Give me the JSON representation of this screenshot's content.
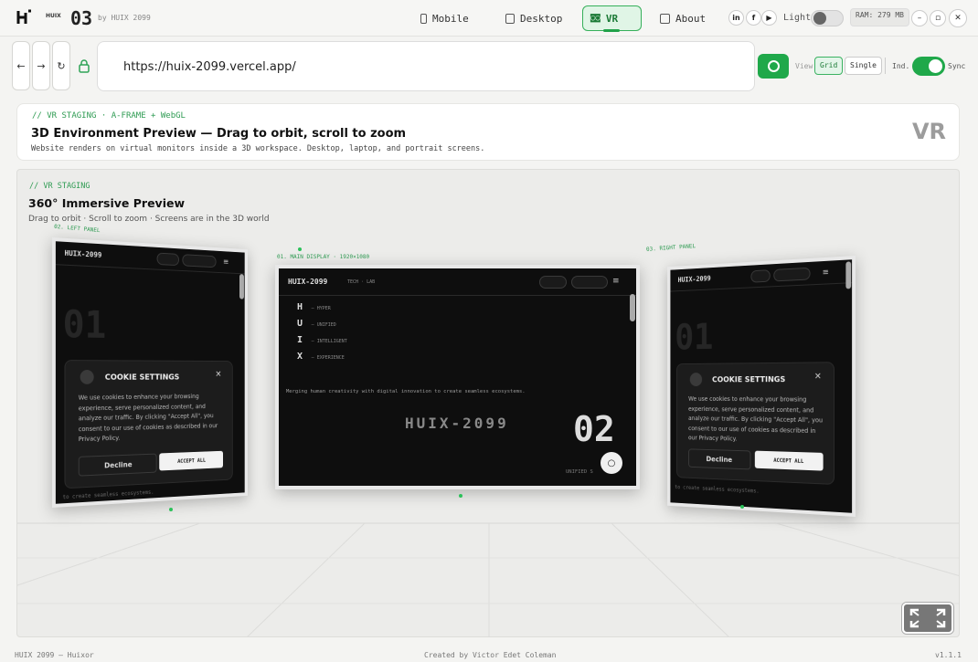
{
  "topbar": {
    "logo_icon": "huix-logo-icon",
    "brand_small": "HUIX",
    "number": "03",
    "byline": "by HUIX 2099",
    "nav": [
      {
        "label": "Mobile",
        "icon": "mobile-icon",
        "active": false
      },
      {
        "label": "Desktop",
        "icon": "desktop-icon",
        "active": false
      },
      {
        "label": "VR",
        "icon": "vr-headset-icon",
        "active": true
      },
      {
        "label": "About",
        "icon": "info-icon",
        "active": false
      }
    ],
    "social": [
      "in",
      "f",
      "▶"
    ],
    "theme_label": "Light",
    "ram": "RAM: 279 MB",
    "window_controls": [
      "–",
      "▫",
      "✕"
    ]
  },
  "browser": {
    "back": "←",
    "forward": "→",
    "reload": "↻",
    "url": "https://huix-2099.vercel.app/",
    "view_label": "View",
    "view_options": [
      {
        "label": "Grid",
        "active": true
      },
      {
        "label": "Single",
        "active": false
      }
    ],
    "ind_label": "Ind.",
    "sync_label": "Sync",
    "sync_on": true
  },
  "info_card": {
    "kicker": "// VR STAGING · A-FRAME + WebGL",
    "title": "3D Environment Preview — Drag to orbit, scroll to zoom",
    "description": "Website renders on virtual monitors inside a 3D workspace. Desktop, laptop, and portrait screens.",
    "badge": "VR"
  },
  "stage": {
    "kicker": "// VR STAGING",
    "title": "360° Immersive Preview",
    "subtitle": "Drag to orbit · Scroll to zoom · Screens are in the 3D world",
    "panels": {
      "left": {
        "label": "02. LEFT PANEL",
        "site": "HUIX-2099",
        "big_number": "01",
        "cookie_title": "COOKIE SETTINGS",
        "cookie_body": "We use cookies to enhance your browsing experience, serve personalized content, and analyze our traffic. By clicking \"Accept All\", you consent to our use of cookies as described in our Privacy Policy.",
        "decline": "Decline",
        "accept": "ACCEPT ALL",
        "footer": "to create seamless ecosystems."
      },
      "main": {
        "label": "01. MAIN DISPLAY · 1920×1080",
        "site": "HUIX-2099",
        "site_tag": "TECH · LAB",
        "acronym": [
          {
            "letter": "H",
            "word": "— HYPER"
          },
          {
            "letter": "U",
            "word": "— UNIFIED"
          },
          {
            "letter": "I",
            "word": "— INTELLIGENT"
          },
          {
            "letter": "X",
            "word": "— EXPERIENCE"
          }
        ],
        "tagline": "Merging human creativity with digital innovation to create seamless ecosystems.",
        "wordmark": "HUIX-2099",
        "big_number": "02",
        "section": "UNIFIED S"
      },
      "right": {
        "label": "03. RIGHT PANEL",
        "site": "HUIX-2099",
        "big_number": "01",
        "cookie_title": "COOKIE SETTINGS",
        "cookie_body": "We use cookies to enhance your browsing experience, serve personalized content, and analyze our traffic. By clicking \"Accept All\", you consent to our use of cookies as described in our Privacy Policy.",
        "decline": "Decline",
        "accept": "ACCEPT ALL",
        "footer": "to create seamless ecosystems."
      }
    },
    "fullscreen_icon": "fullscreen-icon"
  },
  "statusbar": {
    "left": "HUIX 2099 — Huixor",
    "center": "Created by Victor Edet Coleman",
    "right": "v1.1.1"
  }
}
